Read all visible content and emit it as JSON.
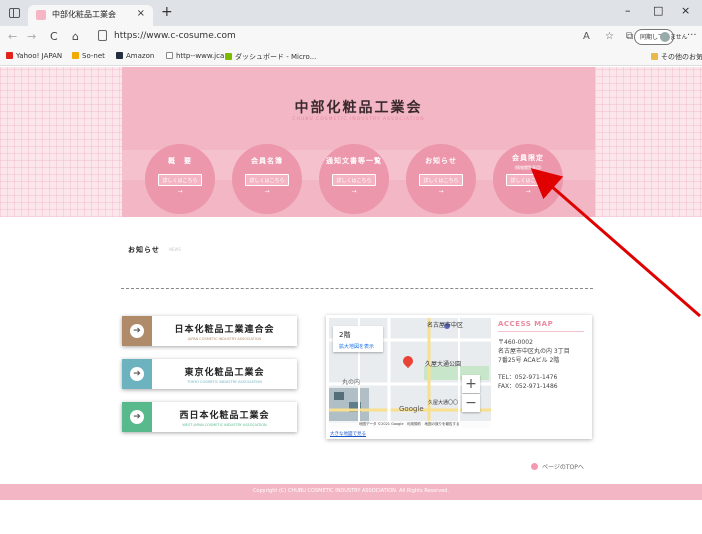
{
  "browser": {
    "tab_title": "中部化粧品工業会",
    "tab_close": "×",
    "new_tab": "+",
    "url": "https://www.c-cosume.com",
    "sync_label": "同期していません",
    "window_min": "–",
    "window_max": "□",
    "window_close": "×",
    "nav_back": "←",
    "nav_forward": "→",
    "nav_reload": "C",
    "nav_home": "⌂",
    "toolbar_aa": "A",
    "toolbar_fav": "☆",
    "toolbar_collections": "⧉",
    "more": "···",
    "favorites": [
      {
        "label": "Yahoo! JAPAN",
        "icon": "yahoo-icon",
        "color": "#e2231a"
      },
      {
        "label": "So-net",
        "icon": "sonet-icon",
        "color": "#f2a900"
      },
      {
        "label": "Amazon",
        "icon": "amazon-icon",
        "color": "#232f3e"
      },
      {
        "label": "http--www.jca",
        "icon": "page-icon",
        "color": "#ffffff"
      },
      {
        "label": "ダッシュボード - Micro...",
        "icon": "dashboard-icon",
        "color": "#7cbb00"
      }
    ],
    "other_favorites": "その他のお気に入り"
  },
  "site": {
    "title": "中部化粧品工業会",
    "subtitle": "CHUBU COSMETIC INDUSTRY ASSOCIATION",
    "nav": [
      {
        "label": "概　要",
        "sub": "",
        "button": "詳しくはこちら",
        "arrow": "→"
      },
      {
        "label": "会員名簿",
        "sub": "",
        "button": "詳しくはこちら",
        "arrow": "→"
      },
      {
        "label": "通知文書等一覧",
        "sub": "",
        "button": "詳しくはこちら",
        "arrow": "→"
      },
      {
        "label": "お知らせ",
        "sub": "",
        "button": "詳しくはこちら",
        "arrow": "→"
      },
      {
        "label": "会員限定",
        "sub": "(情報閲覧専用)",
        "button": "詳しくはこちら",
        "arrow": "→"
      }
    ],
    "news_heading": "お知らせ",
    "news_sub": "NEWS",
    "orgs": [
      {
        "name": "日本化粧品工業連合会",
        "en": "JAPAN COSMETIC INDUSTRY ASSOCIATION",
        "color": "#b08b6a",
        "text_color": "#b08b6a",
        "arrow": "➔"
      },
      {
        "name": "東京化粧品工業会",
        "en": "TOKYO COSMETIC INDUSTRY ASSOCIATION",
        "color": "#6cb2bf",
        "text_color": "#6cb2bf",
        "arrow": "➔"
      },
      {
        "name": "西日本化粧品工業会",
        "en": "WEST JAPAN COSMETIC INDUSTRY ASSOCIATION",
        "color": "#58b98c",
        "text_color": "#58b98c",
        "arrow": "➔"
      }
    ],
    "map": {
      "popup_title": "2階",
      "popup_link": "拡大地図を表示",
      "station_top": "名古屋市中区",
      "station_mid": "久屋大通公園",
      "station_bot": "久屋大通〇〇",
      "label_maru": "丸の内",
      "zoom_in": "+",
      "zoom_out": "−",
      "google": "Google",
      "footer": "地図データ ©2021 Google　利用規約　地図の誤りを報告する",
      "link": "大きな地図で見る"
    },
    "access": {
      "title": "ACCESS MAP",
      "postal": "〒460-0002",
      "address1": "名古屋市中区丸の内 3丁目",
      "address2": "7番25号 ACAビル 2階",
      "tel": "TEL：052-971-1476",
      "fax": "FAX：052-971-1486"
    },
    "page_top": "ページのTOPへ",
    "copyright": "Copyright (C) CHUBU COSMETIC INDUSTRY ASSOCIATION. All Rights Reserved."
  },
  "colors": {
    "accent_pink": "#ec97ac",
    "annotation_red": "#e00000"
  }
}
